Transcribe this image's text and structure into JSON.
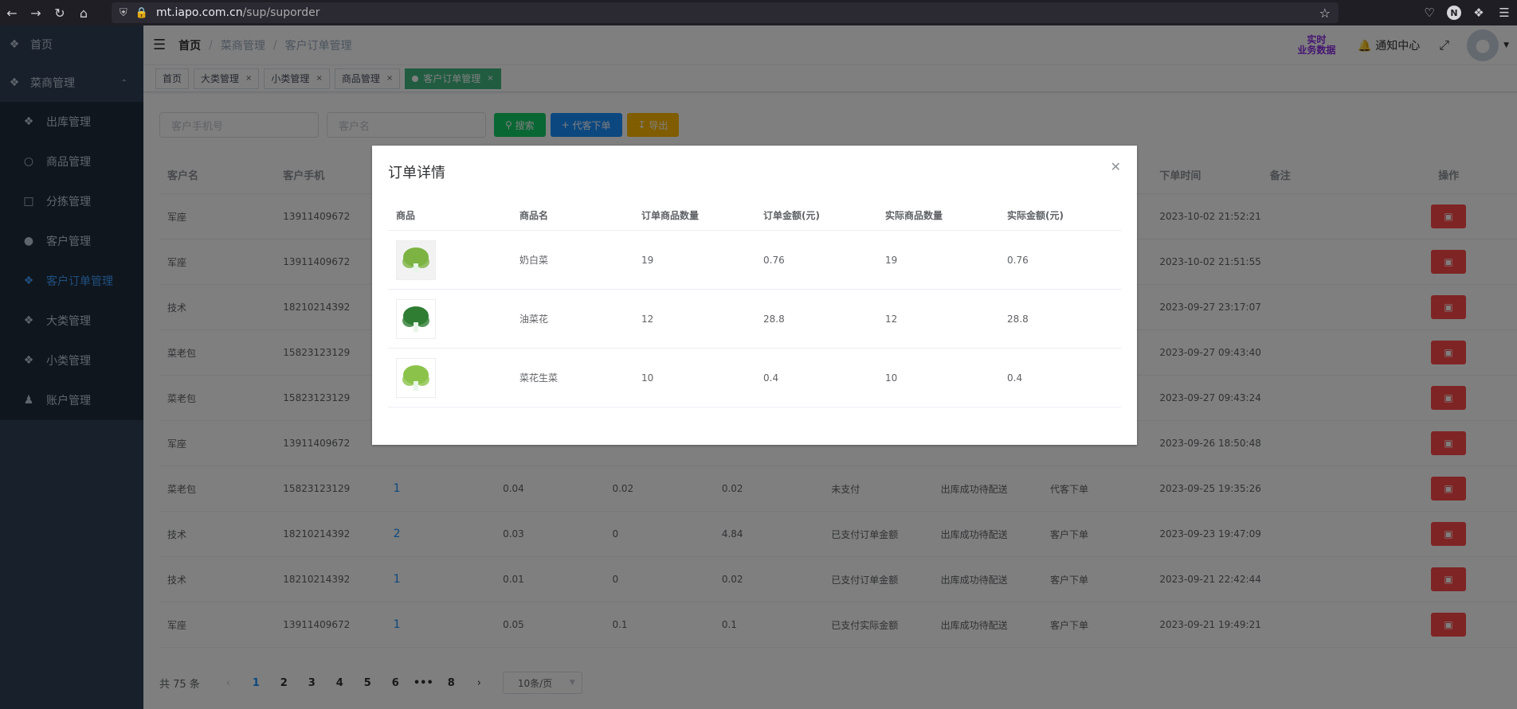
{
  "browser": {
    "url_host": "mt.iapo.com.cn",
    "url_path": "/sup/suporder",
    "avatar_letter": "N"
  },
  "sidebar": {
    "home": "首页",
    "group": "菜商管理",
    "items": [
      {
        "label": "出库管理"
      },
      {
        "label": "商品管理"
      },
      {
        "label": "分拣管理"
      },
      {
        "label": "客户管理"
      },
      {
        "label": "客户订单管理",
        "active": true
      },
      {
        "label": "大类管理"
      },
      {
        "label": "小类管理"
      },
      {
        "label": "账户管理"
      }
    ]
  },
  "header": {
    "breadcrumb": [
      "首页",
      "菜商管理",
      "客户订单管理"
    ],
    "realtime_line1": "实时",
    "realtime_line2": "业务数据",
    "notice": "通知中心"
  },
  "tags": [
    "首页",
    "大类管理",
    "小类管理",
    "商品管理",
    "客户订单管理"
  ],
  "filters": {
    "phone_placeholder": "客户手机号",
    "name_placeholder": "客户名",
    "search": "搜索",
    "proxy_order": "代客下单",
    "export": "导出"
  },
  "table": {
    "columns": [
      "客户名",
      "客户手机",
      "",
      "",
      "",
      "",
      "",
      "",
      "",
      "下单时间",
      "备注",
      "操作"
    ],
    "rows": [
      {
        "name": "军座",
        "phone": "13911409672",
        "count": "",
        "a": "",
        "b": "",
        "c": "",
        "pay": "",
        "status": "",
        "type": "",
        "time": "2023-10-02 21:52:21"
      },
      {
        "name": "军座",
        "phone": "13911409672",
        "count": "",
        "a": "",
        "b": "",
        "c": "",
        "pay": "",
        "status": "",
        "type": "",
        "time": "2023-10-02 21:51:55"
      },
      {
        "name": "技术",
        "phone": "18210214392",
        "count": "",
        "a": "",
        "b": "",
        "c": "",
        "pay": "",
        "status": "",
        "type": "",
        "time": "2023-09-27 23:17:07"
      },
      {
        "name": "菜老包",
        "phone": "15823123129",
        "count": "",
        "a": "",
        "b": "",
        "c": "",
        "pay": "",
        "status": "",
        "type": "",
        "time": "2023-09-27 09:43:40"
      },
      {
        "name": "菜老包",
        "phone": "15823123129",
        "count": "",
        "a": "",
        "b": "",
        "c": "",
        "pay": "",
        "status": "",
        "type": "",
        "time": "2023-09-27 09:43:24"
      },
      {
        "name": "军座",
        "phone": "13911409672",
        "count": "",
        "a": "",
        "b": "",
        "c": "",
        "pay": "",
        "status": "",
        "type": "",
        "time": "2023-09-26 18:50:48"
      },
      {
        "name": "菜老包",
        "phone": "15823123129",
        "count": "1",
        "a": "0.04",
        "b": "0.02",
        "c": "0.02",
        "pay": "未支付",
        "status": "出库成功待配送",
        "type": "代客下单",
        "time": "2023-09-25 19:35:26"
      },
      {
        "name": "技术",
        "phone": "18210214392",
        "count": "2",
        "a": "0.03",
        "b": "0",
        "c": "4.84",
        "pay": "已支付订单金额",
        "status": "出库成功待配送",
        "type": "客户下单",
        "time": "2023-09-23 19:47:09"
      },
      {
        "name": "技术",
        "phone": "18210214392",
        "count": "1",
        "a": "0.01",
        "b": "0",
        "c": "0.02",
        "pay": "已支付订单金额",
        "status": "出库成功待配送",
        "type": "客户下单",
        "time": "2023-09-21 22:42:44"
      },
      {
        "name": "军座",
        "phone": "13911409672",
        "count": "1",
        "a": "0.05",
        "b": "0.1",
        "c": "0.1",
        "pay": "已支付实际金额",
        "status": "出库成功待配送",
        "type": "客户下单",
        "time": "2023-09-21 19:49:21"
      }
    ]
  },
  "pagination": {
    "total": "共 75 条",
    "pages": [
      "1",
      "2",
      "3",
      "4",
      "5",
      "6",
      "•••",
      "8"
    ],
    "page_size": "10条/页"
  },
  "dialog": {
    "title": "订单详情",
    "columns": [
      "商品",
      "商品名",
      "订单商品数量",
      "订单金额(元)",
      "实际商品数量",
      "实际金额(元)"
    ],
    "rows": [
      {
        "name": "奶白菜",
        "order_qty": "19",
        "order_amt": "0.76",
        "real_qty": "19",
        "real_amt": "0.76"
      },
      {
        "name": "油菜花",
        "order_qty": "12",
        "order_amt": "28.8",
        "real_qty": "12",
        "real_amt": "28.8"
      },
      {
        "name": "菜花生菜",
        "order_qty": "10",
        "order_amt": "0.4",
        "real_qty": "10",
        "real_amt": "0.4"
      }
    ]
  },
  "colors": {
    "sidebar_bg": "#304156",
    "active_menu": "#409eff",
    "tag_active": "#42b983",
    "danger": "#ff4949",
    "realtime": "#8a2be2"
  }
}
